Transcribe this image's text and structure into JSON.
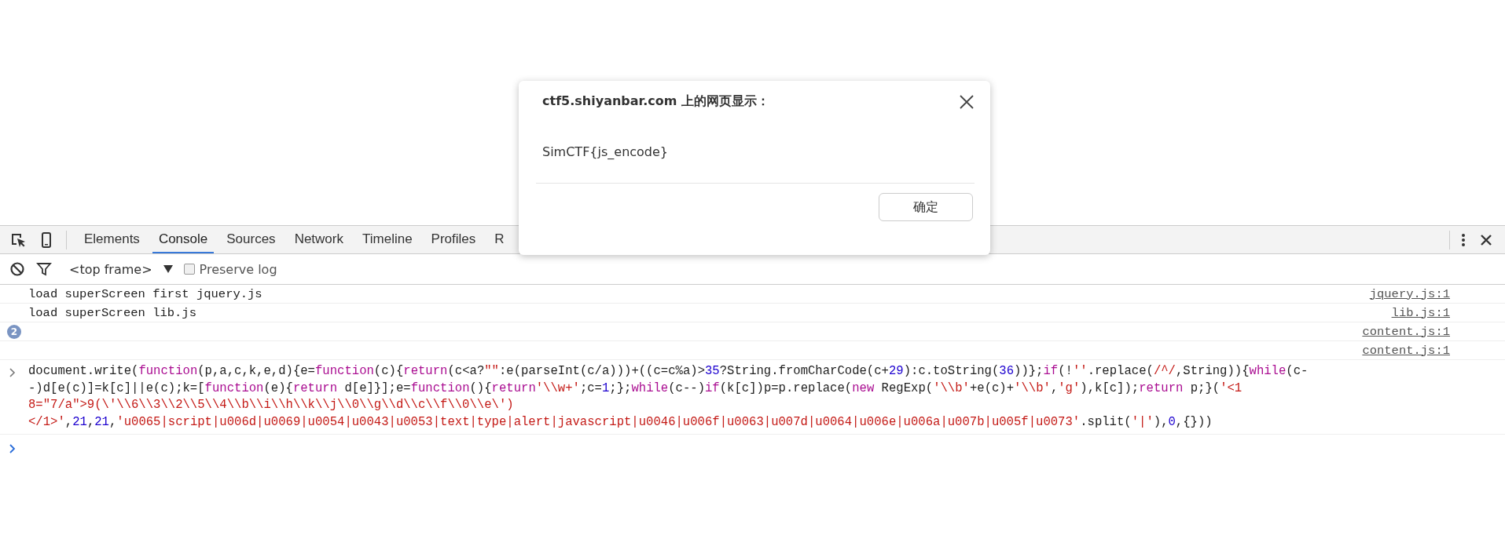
{
  "dialog": {
    "title": "ctf5.shiyanbar.com 上的网页显示：",
    "message": "SimCTF{js_encode}",
    "button": "确定"
  },
  "devtools": {
    "tabs": [
      {
        "label": "Elements",
        "selected": false
      },
      {
        "label": "Console",
        "selected": true
      },
      {
        "label": "Sources",
        "selected": false
      },
      {
        "label": "Network",
        "selected": false
      },
      {
        "label": "Timeline",
        "selected": false
      },
      {
        "label": "Profiles",
        "selected": false
      },
      {
        "label": "R",
        "selected": false
      }
    ],
    "filter": {
      "context": "<top frame>",
      "preserve_log": {
        "label": "Preserve log",
        "checked": false
      }
    },
    "messages": [
      {
        "text": "load superScreen first jquery.js",
        "source": "jquery.js:1"
      },
      {
        "text": "load superScreen lib.js",
        "source": "lib.js:1"
      },
      {
        "count": "2",
        "source": "content.js:1"
      },
      {
        "source": "content.js:1"
      }
    ],
    "command": {
      "lines": [
        [
          {
            "t": "document.write(",
            "kind": "plain"
          },
          {
            "t": "function",
            "kind": "keyword"
          },
          {
            "t": "(p,a,c,k,e,d){e=",
            "kind": "plain"
          },
          {
            "t": "function",
            "kind": "keyword"
          },
          {
            "t": "(c){",
            "kind": "plain"
          },
          {
            "t": "return",
            "kind": "keyword"
          },
          {
            "t": "(c<a?",
            "kind": "plain"
          },
          {
            "t": "\"\"",
            "kind": "string"
          },
          {
            "t": ":e(parseInt(c/a)))+((c=c%a)>",
            "kind": "plain"
          },
          {
            "t": "35",
            "kind": "number"
          },
          {
            "t": "?String.fromCharCode(c+",
            "kind": "plain"
          },
          {
            "t": "29",
            "kind": "number"
          },
          {
            "t": "):c.toString(",
            "kind": "plain"
          },
          {
            "t": "36",
            "kind": "number"
          },
          {
            "t": "))};",
            "kind": "plain"
          },
          {
            "t": "if",
            "kind": "keyword"
          },
          {
            "t": "(!",
            "kind": "plain"
          },
          {
            "t": "''",
            "kind": "string"
          },
          {
            "t": ".replace(",
            "kind": "plain"
          },
          {
            "t": "/^/",
            "kind": "string"
          },
          {
            "t": ",String)){",
            "kind": "plain"
          },
          {
            "t": "while",
            "kind": "keyword"
          },
          {
            "t": "(c-",
            "kind": "plain"
          }
        ],
        [
          {
            "t": "-)d[e(c)]=k[c]||e(c);k=[",
            "kind": "plain"
          },
          {
            "t": "function",
            "kind": "keyword"
          },
          {
            "t": "(e){",
            "kind": "plain"
          },
          {
            "t": "return",
            "kind": "keyword"
          },
          {
            "t": " d[e]}];e=",
            "kind": "plain"
          },
          {
            "t": "function",
            "kind": "keyword"
          },
          {
            "t": "(){",
            "kind": "plain"
          },
          {
            "t": "return",
            "kind": "keyword"
          },
          {
            "t": "'\\\\w+'",
            "kind": "string"
          },
          {
            "t": ";c=",
            "kind": "plain"
          },
          {
            "t": "1",
            "kind": "number"
          },
          {
            "t": ";};",
            "kind": "plain"
          },
          {
            "t": "while",
            "kind": "keyword"
          },
          {
            "t": "(c--)",
            "kind": "plain"
          },
          {
            "t": "if",
            "kind": "keyword"
          },
          {
            "t": "(k[c])p=p.replace(",
            "kind": "plain"
          },
          {
            "t": "new",
            "kind": "keyword"
          },
          {
            "t": " RegExp(",
            "kind": "plain"
          },
          {
            "t": "'\\\\b'",
            "kind": "string"
          },
          {
            "t": "+e(c)+",
            "kind": "plain"
          },
          {
            "t": "'\\\\b'",
            "kind": "string"
          },
          {
            "t": ",",
            "kind": "plain"
          },
          {
            "t": "'g'",
            "kind": "string"
          },
          {
            "t": "),k[c]);",
            "kind": "plain"
          },
          {
            "t": "return",
            "kind": "keyword"
          },
          {
            "t": " p;}(",
            "kind": "plain"
          },
          {
            "t": "'<1",
            "kind": "string"
          }
        ],
        [
          {
            "t": "8=\"7/a\">9(\\'\\\\6\\\\3\\\\2\\\\5\\\\4\\\\b\\\\i\\\\h\\\\k\\\\j\\\\0\\\\g\\\\d\\\\c\\\\f\\\\0\\\\e\\')",
            "kind": "string"
          }
        ],
        [
          {
            "t": "</1>'",
            "kind": "string"
          },
          {
            "t": ",",
            "kind": "plain"
          },
          {
            "t": "21",
            "kind": "number"
          },
          {
            "t": ",",
            "kind": "plain"
          },
          {
            "t": "21",
            "kind": "number"
          },
          {
            "t": ",",
            "kind": "plain"
          },
          {
            "t": "'u0065|script|u006d|u0069|u0054|u0043|u0053|text|type|alert|javascript|u0046|u006f|u0063|u007d|u0064|u006e|u006a|u007b|u005f|u0073'",
            "kind": "string"
          },
          {
            "t": ".split(",
            "kind": "plain"
          },
          {
            "t": "'|'",
            "kind": "string"
          },
          {
            "t": "),",
            "kind": "plain"
          },
          {
            "t": "0",
            "kind": "number"
          },
          {
            "t": ",{}))",
            "kind": "plain"
          }
        ]
      ]
    }
  }
}
